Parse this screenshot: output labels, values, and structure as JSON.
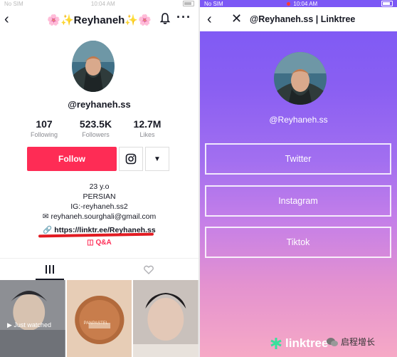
{
  "left": {
    "status": {
      "carrier": "No SIM",
      "time": "10:04 AM"
    },
    "header": {
      "title": "🌸✨Reyhaneh✨🌸"
    },
    "handle": "@reyhaneh.ss",
    "stats": [
      {
        "value": "107",
        "label": "Following"
      },
      {
        "value": "523.5K",
        "label": "Followers"
      },
      {
        "value": "12.7M",
        "label": "Likes"
      }
    ],
    "follow_label": "Follow",
    "bio": {
      "line1": "23 y.o",
      "line2": "PERSIAN",
      "line3": "IG:-reyhaneh.ss2",
      "email": "reyhaneh.sourghali@gmail.com"
    },
    "link": "https://linktr.ee/Reyhaneh.ss",
    "qa_label": "Q&A",
    "videos": [
      {
        "caption": "Just watched"
      },
      {
        "caption": "PANPASTEL"
      },
      {
        "caption": ""
      }
    ]
  },
  "right": {
    "status": {
      "carrier": "No SIM",
      "time": "10:04 AM"
    },
    "header": {
      "title": "@Reyhaneh.ss | Linktree"
    },
    "handle": "@Reyhaneh.ss",
    "links": [
      {
        "label": "Twitter"
      },
      {
        "label": "Instagram"
      },
      {
        "label": "Tiktok"
      }
    ],
    "brand": "linktree",
    "watermark": "启程增长"
  },
  "colors": {
    "follow": "#fe2c55",
    "link_highlight": "#e21b22",
    "linktree_top": "#7b58f5",
    "linktree_bottom": "#f6a9c6"
  }
}
